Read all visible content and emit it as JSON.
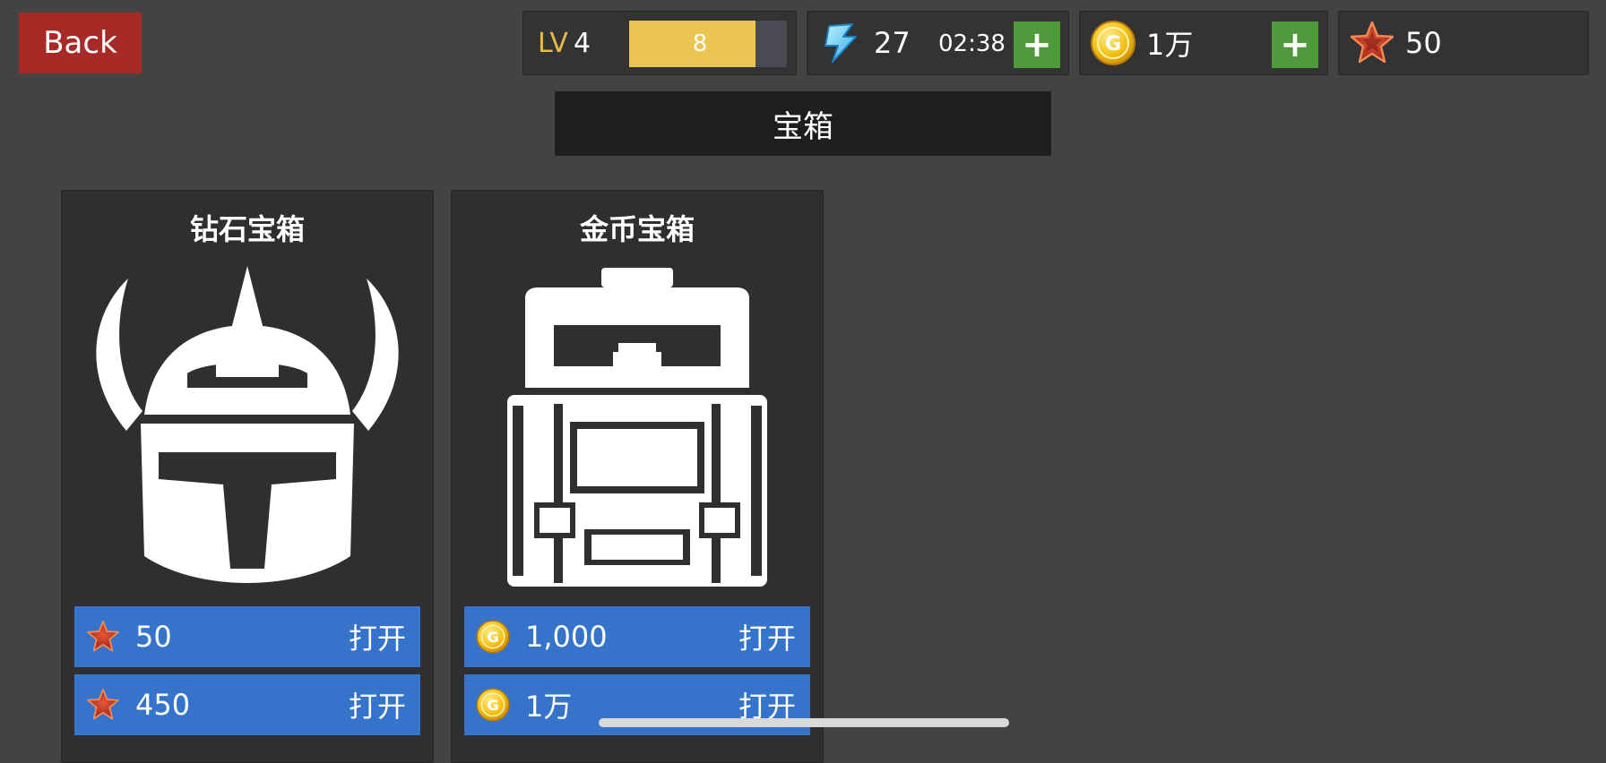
{
  "back_label": "Back",
  "level": {
    "label": "LV",
    "value": "4",
    "xp_text": "8",
    "xp_fraction": 0.8
  },
  "energy": {
    "icon": "lightning-icon",
    "value": "27",
    "timer": "02:38",
    "plus": "+"
  },
  "gold": {
    "icon": "gold-coin-icon",
    "value": "1万",
    "plus": "+"
  },
  "gems": {
    "icon": "red-star-gem-icon",
    "value": "50"
  },
  "page_title": "宝箱",
  "chests": [
    {
      "title": "钻石宝箱",
      "image": "horned-helmet-icon",
      "options": [
        {
          "currency_icon": "red-star-gem-icon",
          "price": "50",
          "action": "打开"
        },
        {
          "currency_icon": "red-star-gem-icon",
          "price": "450",
          "action": "打开"
        }
      ]
    },
    {
      "title": "金币宝箱",
      "image": "backpack-icon",
      "options": [
        {
          "currency_icon": "gold-coin-icon",
          "price": "1,000",
          "action": "打开"
        },
        {
          "currency_icon": "gold-coin-icon",
          "price": "1万",
          "action": "打开"
        }
      ]
    }
  ],
  "colors": {
    "background": "#434343",
    "back_button": "#a72a27",
    "xp_fill": "#ecc452",
    "plus_button": "#4e9a3a",
    "option_button": "#3674cc",
    "level_label": "#e9b949"
  }
}
